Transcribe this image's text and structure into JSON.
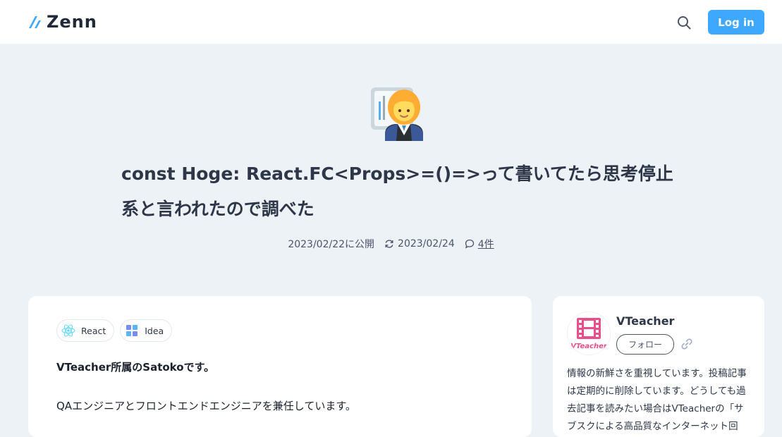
{
  "header": {
    "logo_text": "Zenn",
    "search_icon": "search-icon",
    "login_label": "Log in",
    "brand_color": "#3ea8ff"
  },
  "article": {
    "emoji": "woman-teacher-emoji",
    "title": "const Hoge: React.FC<Props>=()=>って書いてたら思考停止系と言われたので調べた",
    "published": "2023/02/22に公開",
    "updated": "2023/02/24",
    "comments": "4件",
    "tags": [
      {
        "label": "React",
        "icon": "react-icon"
      },
      {
        "label": "Idea",
        "icon": "idea-icon"
      }
    ],
    "paragraphs": [
      "VTeacher所属のSatokoです。",
      "QAエンジニアとフロントエンドエンジニアを兼任しています。"
    ]
  },
  "sidebar": {
    "author_name": "VTeacher",
    "avatar_text": "VTeacher",
    "follow_label": "フォロー",
    "link_icon": "link-icon",
    "bio": "情報の新鮮さを重視しています。投稿記事は定期的に削除しています。どうしても過去記事を読みたい場合はVTeacherの「サブスクによる高品質なインターネット回"
  }
}
